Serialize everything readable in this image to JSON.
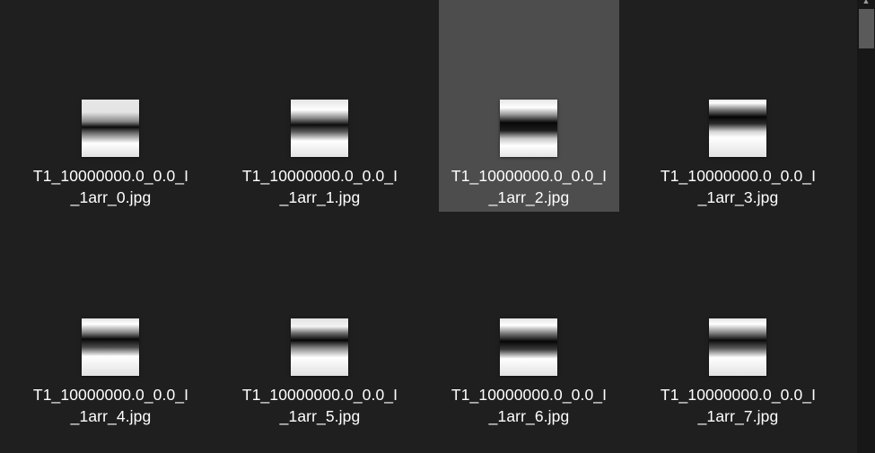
{
  "files": [
    {
      "name_line1": "T1_10000000.0_0.0_I",
      "name_line2": "_1arr_0.jpg",
      "selected": false
    },
    {
      "name_line1": "T1_10000000.0_0.0_I",
      "name_line2": "_1arr_1.jpg",
      "selected": false
    },
    {
      "name_line1": "T1_10000000.0_0.0_I",
      "name_line2": "_1arr_2.jpg",
      "selected": true
    },
    {
      "name_line1": "T1_10000000.0_0.0_I",
      "name_line2": "_1arr_3.jpg",
      "selected": false
    },
    {
      "name_line1": "T1_10000000.0_0.0_I",
      "name_line2": "_1arr_4.jpg",
      "selected": false
    },
    {
      "name_line1": "T1_10000000.0_0.0_I",
      "name_line2": "_1arr_5.jpg",
      "selected": false
    },
    {
      "name_line1": "T1_10000000.0_0.0_I",
      "name_line2": "_1arr_6.jpg",
      "selected": false
    },
    {
      "name_line1": "T1_10000000.0_0.0_I",
      "name_line2": "_1arr_7.jpg",
      "selected": false
    }
  ],
  "colors": {
    "background": "#1f1f1f",
    "selection": "#4d4d4d",
    "text": "#ffffff",
    "scrollbar_thumb": "#5a5a5a"
  },
  "icons": {
    "scroll_up": "triangle-up"
  }
}
